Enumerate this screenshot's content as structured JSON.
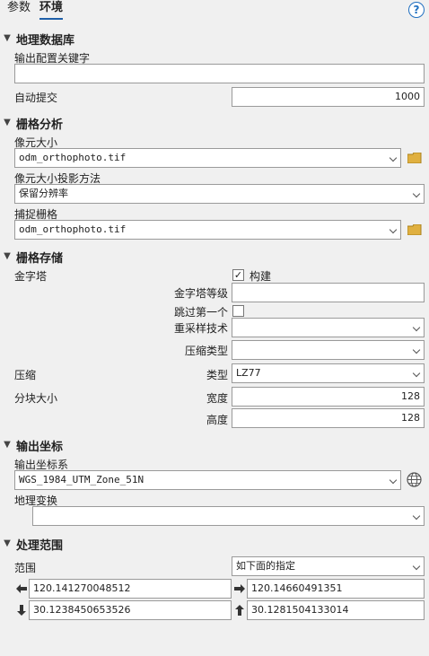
{
  "tabs": {
    "params": "参数",
    "env": "环境"
  },
  "help": "?",
  "sections": {
    "geodb": "地理数据库",
    "raster_analysis": "栅格分析",
    "raster_storage": "栅格存储",
    "output_coords": "输出坐标",
    "extent": "处理范围"
  },
  "geodb": {
    "config_keyword_label": "输出配置关键字",
    "config_keyword_value": "",
    "auto_commit_label": "自动提交",
    "auto_commit_value": "1000"
  },
  "raster_analysis": {
    "cell_size_label": "像元大小",
    "cell_size_value": "odm_orthophoto.tif",
    "projection_method_label": "像元大小投影方法",
    "projection_method_value": "保留分辨率",
    "snap_raster_label": "捕捉栅格",
    "snap_raster_value": "odm_orthophoto.tif"
  },
  "raster_storage": {
    "pyramid_label": "金字塔",
    "build_label": "构建",
    "build_checked": true,
    "pyramid_level_label": "金字塔等级",
    "pyramid_level_value": "",
    "skip_first_label": "跳过第一个",
    "skip_first_checked": false,
    "resampling_label": "重采样技术",
    "resampling_value": "",
    "compression_type_label": "压缩类型",
    "compression_type_value": "",
    "compression_label": "压缩",
    "type_label": "类型",
    "type_value": "LZ77",
    "tile_size_label": "分块大小",
    "width_label": "宽度",
    "width_value": "128",
    "height_label": "高度",
    "height_value": "128"
  },
  "output_coords": {
    "crs_label": "输出坐标系",
    "crs_value": "WGS_1984_UTM_Zone_51N",
    "geo_transform_label": "地理变换",
    "geo_transform_value": ""
  },
  "extent": {
    "extent_label": "范围",
    "extent_value": "如下面的指定",
    "left": "120.141270048512",
    "right": "120.14660491351",
    "bottom": "30.1238450653526",
    "top": "30.1281504133014"
  },
  "colors": {
    "accent": "#1f5fa8",
    "folder": "#e0b040"
  },
  "icons": {
    "collapse": "chevron-down-icon",
    "folder": "folder-icon",
    "globe": "globe-icon",
    "arrows": [
      "arrow-left-icon",
      "arrow-right-icon",
      "arrow-down-icon",
      "arrow-up-icon"
    ]
  }
}
